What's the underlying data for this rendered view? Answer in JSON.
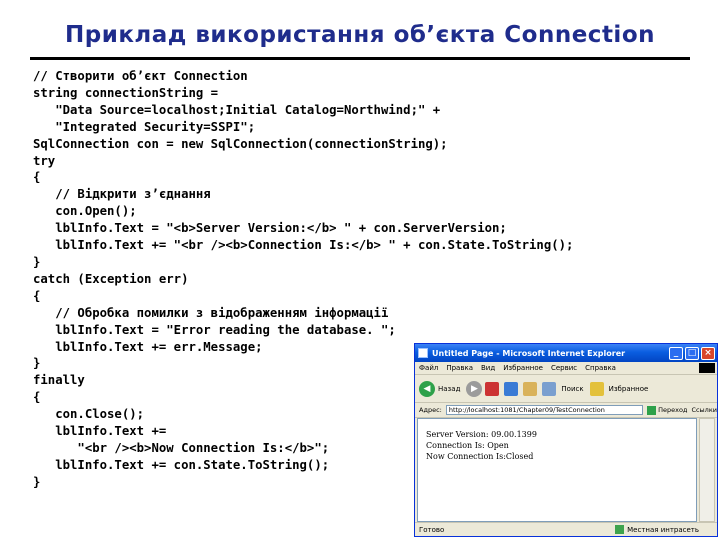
{
  "slide": {
    "title": "Приклад використання об’єкта Connection"
  },
  "code_lines": [
    "// Створити об’єкт Connection",
    "string connectionString =",
    "   \"Data Source=localhost;Initial Catalog=Northwind;\" +",
    "   \"Integrated Security=SSPI\";",
    "SqlConnection con = new SqlConnection(connectionString);",
    "try",
    "{",
    "   // Відкрити з’єднання",
    "   con.Open();",
    "   lblInfo.Text = \"<b>Server Version:</b> \" + con.ServerVersion;",
    "   lblInfo.Text += \"<br /><b>Connection Is:</b> \" + con.State.ToString();",
    "}",
    "catch (Exception err)",
    "{",
    "   // Обробка помилки з відображенням інформації",
    "   lblInfo.Text = \"Error reading the database. \";",
    "   lblInfo.Text += err.Message;",
    "}",
    "finally",
    "{",
    "   con.Close();",
    "   lblInfo.Text +=",
    "      \"<br /><b>Now Connection Is:</b>\";",
    "   lblInfo.Text += con.State.ToString();",
    "}"
  ],
  "browser": {
    "title": "Untitled Page - Microsoft Internet Explorer",
    "menu": [
      "Файл",
      "Правка",
      "Вид",
      "Избранное",
      "Сервис",
      "Справка"
    ],
    "toolbar": {
      "back_label": "Назад",
      "search_label": "Поиск",
      "favorites_label": "Избранное"
    },
    "address_label": "Адрес:",
    "address_value": "http://localhost:1081/Chapter09/TestConnection",
    "go_label": "Переход",
    "links_label": "Ссылки",
    "content_lines": [
      "Server Version: 09.00.1399",
      "Connection Is: Open",
      "Now Connection Is:Closed"
    ],
    "status_left": "Готово",
    "status_zone": "Местная интрасеть"
  },
  "colors": {
    "title": "#1f2c8c",
    "titlebar": "#0a5ee0"
  }
}
